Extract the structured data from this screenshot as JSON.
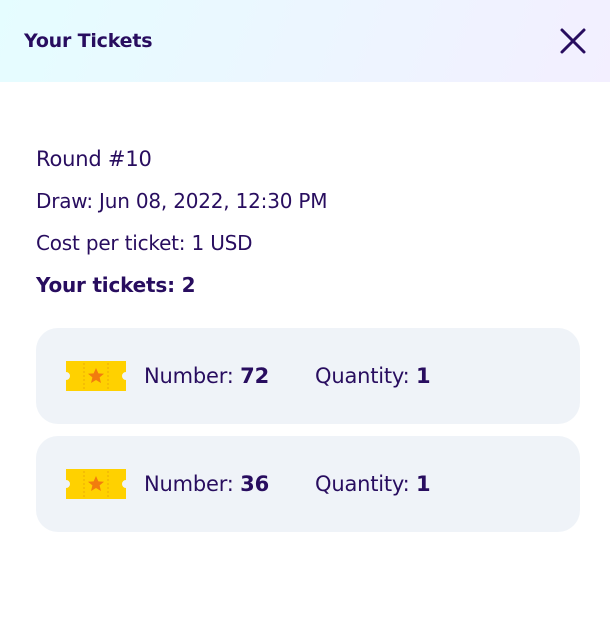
{
  "header": {
    "title": "Your Tickets",
    "close_icon": "close-icon"
  },
  "round": {
    "label": "Round #10",
    "draw": "Draw: Jun 08, 2022, 12:30 PM",
    "cost": "Cost per ticket: 1 USD",
    "your_tickets": "Your tickets: 2"
  },
  "tickets": [
    {
      "number_label": "Number:",
      "number": "72",
      "quantity_label": "Quantity:",
      "quantity": "1",
      "icon": "ticket-icon"
    },
    {
      "number_label": "Number:",
      "number": "36",
      "quantity_label": "Quantity:",
      "quantity": "1",
      "icon": "ticket-icon"
    }
  ],
  "colors": {
    "text": "#280D5F",
    "ticket_bg": "#EFF3F8",
    "ticket_yellow": "#FFD100",
    "star_orange": "#F27C0E"
  }
}
